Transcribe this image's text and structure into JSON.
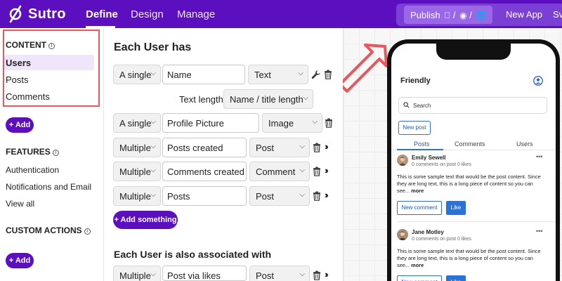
{
  "header": {
    "brand": "Sutro",
    "tabs": [
      "Define",
      "Design",
      "Manage"
    ],
    "publish_label": "Publish",
    "new_app_label": "New App",
    "overflow_label": "Sv"
  },
  "sidebar": {
    "content_title": "CONTENT",
    "content_items": [
      "Users",
      "Posts",
      "Comments"
    ],
    "add_label": "+ Add",
    "features_title": "FEATURES",
    "feature_items": [
      "Authentication",
      "Notifications and Email",
      "View all"
    ],
    "custom_actions_title": "CUSTOM ACTIONS",
    "add_label_2": "+ Add"
  },
  "editor": {
    "title": "Each User has",
    "text_length_label": "Text length:",
    "text_length_value": "Name / title length",
    "rows": [
      {
        "cardinality": "A single",
        "name": "Name",
        "type": "Text"
      },
      {
        "cardinality": "A single",
        "name": "Profile Picture",
        "type": "Image"
      },
      {
        "cardinality": "Multiple",
        "name": "Posts created",
        "type": "Post"
      },
      {
        "cardinality": "Multiple",
        "name": "Comments created",
        "type": "Comment"
      },
      {
        "cardinality": "Multiple",
        "name": "Posts",
        "type": "Post"
      }
    ],
    "add_something_label": "+ Add something",
    "assoc_title": "Each User is also associated with",
    "assoc_rows": [
      {
        "cardinality": "Multiple",
        "name": "Post via likes",
        "type": "Post"
      }
    ]
  },
  "phone": {
    "title": "Friendly",
    "search_placeholder": "Search",
    "new_post_label": "New post",
    "tabs": [
      "Posts",
      "Comments",
      "Users"
    ],
    "cards": [
      {
        "author": "Emily Sewell",
        "meta": "0 comments on post  0 likes",
        "body": "This is some sample text that would be the post content. Since they are long text, this is a long piece of content so you can see...",
        "more": "more",
        "new_comment_label": "New comment",
        "like_label": "Like"
      },
      {
        "author": "Jane Motley",
        "meta": "0 comments on post  0 likes",
        "body": "This is some sample text that would be the post content. Since they are long text, this is a long piece of content so you can see...",
        "more": "more",
        "new_comment_label": "New comment",
        "like_label": "Like"
      }
    ]
  },
  "colors": {
    "brand_purple": "#5b0fbf",
    "highlight_red": "#e8575b",
    "link_blue": "#2a72d6"
  }
}
